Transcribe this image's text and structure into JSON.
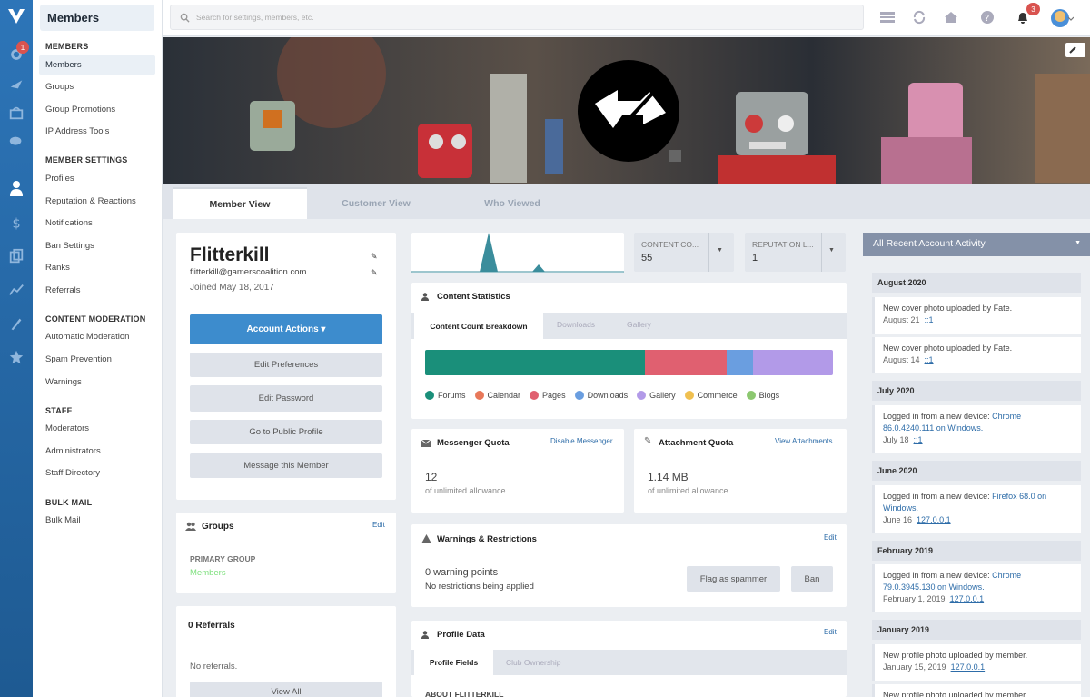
{
  "sidebar": {
    "title": "Members",
    "notif_badge": "1",
    "sections": [
      {
        "title": "MEMBERS",
        "items": [
          "Members",
          "Groups",
          "Group Promotions",
          "IP Address Tools"
        ]
      },
      {
        "title": "MEMBER SETTINGS",
        "items": [
          "Profiles",
          "Reputation & Reactions",
          "Notifications",
          "Ban Settings",
          "Ranks",
          "Referrals"
        ]
      },
      {
        "title": "CONTENT MODERATION",
        "items": [
          "Automatic Moderation",
          "Spam Prevention",
          "Warnings"
        ]
      },
      {
        "title": "STAFF",
        "items": [
          "Moderators",
          "Administrators",
          "Staff Directory"
        ]
      },
      {
        "title": "BULK MAIL",
        "items": [
          "Bulk Mail"
        ]
      }
    ]
  },
  "topbar": {
    "search_placeholder": "Search for settings, members, etc.",
    "notif_count": "3"
  },
  "tabs": [
    "Member View",
    "Customer View",
    "Who Viewed"
  ],
  "profile": {
    "name": "Flitterkill",
    "email": "flitterkill@gamerscoalition.com",
    "joined": "Joined May 18, 2017",
    "actions_label": "Account Actions",
    "buttons": [
      "Edit Preferences",
      "Edit Password",
      "Go to Public Profile",
      "Message this Member"
    ]
  },
  "groups": {
    "title": "Groups",
    "edit": "Edit",
    "primary_label": "PRIMARY GROUP",
    "primary_value": "Members"
  },
  "referrals": {
    "title": "0 Referrals",
    "empty": "No referrals.",
    "view_all": "View All"
  },
  "stats": {
    "content_count_label": "CONTENT CO...",
    "content_count": "55",
    "reputation_label": "REPUTATION L...",
    "reputation": "1"
  },
  "content_stats": {
    "title": "Content Statistics",
    "tabs": [
      "Content Count Breakdown",
      "Downloads",
      "Gallery"
    ],
    "legend": [
      {
        "name": "Forums",
        "color": "#1a8f7a"
      },
      {
        "name": "Calendar",
        "color": "#e8785a"
      },
      {
        "name": "Pages",
        "color": "#e06070"
      },
      {
        "name": "Downloads",
        "color": "#6a9ee0"
      },
      {
        "name": "Gallery",
        "color": "#b29ae8"
      },
      {
        "name": "Commerce",
        "color": "#f0c050"
      },
      {
        "name": "Blogs",
        "color": "#8cc870"
      }
    ],
    "bar_shares": [
      0.54,
      0.2,
      0.065,
      0.195
    ]
  },
  "messenger": {
    "title": "Messenger Quota",
    "link": "Disable Messenger",
    "value": "12",
    "sub": "of unlimited allowance"
  },
  "attachment": {
    "title": "Attachment Quota",
    "link": "View Attachments",
    "value": "1.14 MB",
    "sub": "of unlimited allowance"
  },
  "warnings": {
    "title": "Warnings & Restrictions",
    "edit": "Edit",
    "points": "0 warning points",
    "restrictions": "No restrictions being applied",
    "flag": "Flag as spammer",
    "ban": "Ban"
  },
  "profile_data": {
    "title": "Profile Data",
    "edit": "Edit",
    "tabs": [
      "Profile Fields",
      "Club Ownership"
    ],
    "about": "ABOUT FLITTERKILL"
  },
  "activity": {
    "title": "All Recent Account Activity",
    "entries": [
      {
        "month": "August 2020"
      },
      {
        "text": "New cover photo uploaded by Fate.",
        "date": "August 21",
        "ip": "::1"
      },
      {
        "text": "New cover photo uploaded by Fate.",
        "date": "August 14",
        "ip": "::1"
      },
      {
        "month": "July 2020"
      },
      {
        "text": "Logged in from a new device: ",
        "link": "Chrome 86.0.4240.111 on Windows.",
        "date": "July 18",
        "ip": "::1"
      },
      {
        "month": "June 2020"
      },
      {
        "text": "Logged in from a new device: ",
        "link": "Firefox 68.0 on Windows.",
        "date": "June 16",
        "ip": "127.0.0.1"
      },
      {
        "month": "February 2019"
      },
      {
        "text": "Logged in from a new device: ",
        "link": "Chrome 79.0.3945.130 on Windows.",
        "date": "February 1, 2019",
        "ip": "127.0.0.1"
      },
      {
        "month": "January 2019"
      },
      {
        "text": "New profile photo uploaded by member.",
        "date": "January 15, 2019",
        "ip": "127.0.0.1"
      },
      {
        "text": "New profile photo uploaded by member.",
        "date": "",
        "ip": ""
      }
    ]
  }
}
